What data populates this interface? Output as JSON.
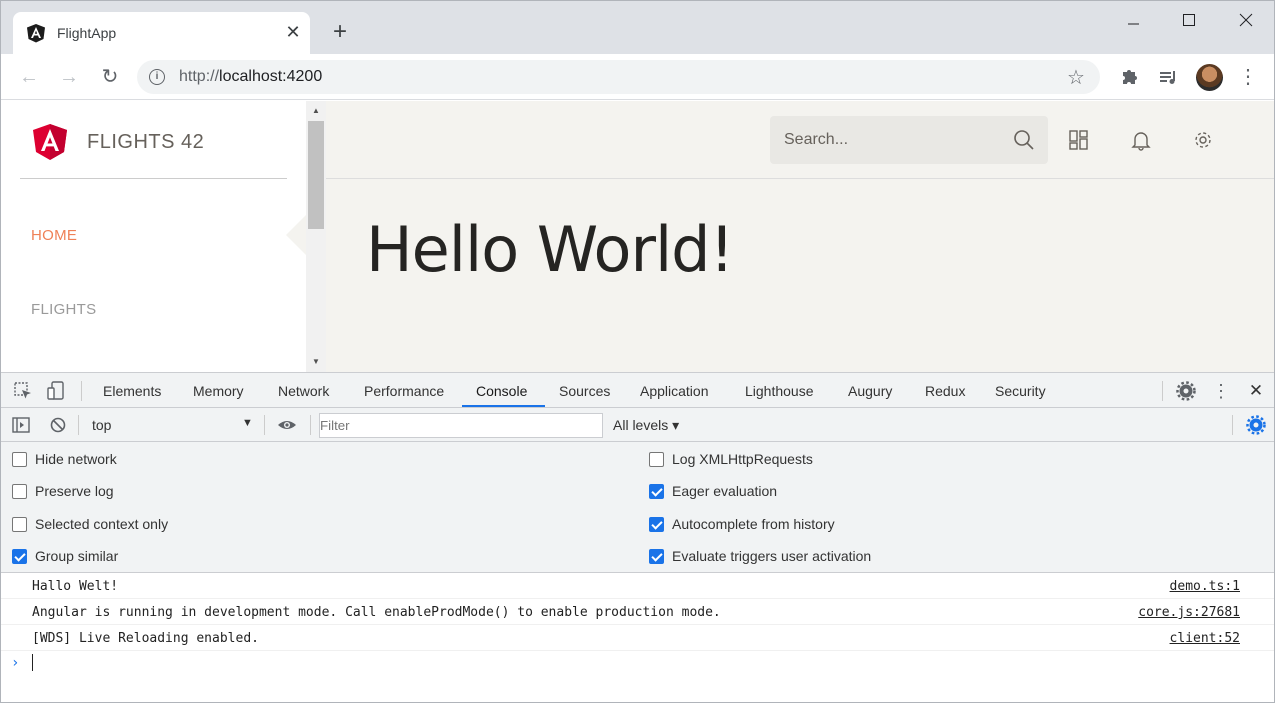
{
  "browser": {
    "tab_title": "FlightApp",
    "url_scheme": "http://",
    "url_host": "localhost:4200"
  },
  "app": {
    "brand": "FLIGHTS 42",
    "nav": [
      {
        "label": "HOME",
        "active": true
      },
      {
        "label": "FLIGHTS",
        "active": false
      }
    ],
    "search_placeholder": "Search...",
    "heading": "Hello World!",
    "accent_color": "#ef8157"
  },
  "devtools": {
    "tabs": [
      "Elements",
      "Memory",
      "Network",
      "Performance",
      "Console",
      "Sources",
      "Application",
      "Lighthouse",
      "Augury",
      "Redux",
      "Security"
    ],
    "active_tab": "Console",
    "context": "top",
    "filter_placeholder": "Filter",
    "levels": "All levels ▾",
    "options_left": [
      {
        "label": "Hide network",
        "checked": false
      },
      {
        "label": "Preserve log",
        "checked": false
      },
      {
        "label": "Selected context only",
        "checked": false
      },
      {
        "label": "Group similar",
        "checked": true
      }
    ],
    "options_right": [
      {
        "label": "Log XMLHttpRequests",
        "checked": false
      },
      {
        "label": "Eager evaluation",
        "checked": true
      },
      {
        "label": "Autocomplete from history",
        "checked": true
      },
      {
        "label": "Evaluate triggers user activation",
        "checked": true
      }
    ],
    "messages": [
      {
        "text": "Hallo Welt!",
        "source": "demo.ts:1"
      },
      {
        "text": "Angular is running in development mode. Call enableProdMode() to enable production mode.",
        "source": "core.js:27681"
      },
      {
        "text": "[WDS] Live Reloading enabled.",
        "source": "client:52"
      }
    ],
    "prompt_symbol": "›"
  }
}
